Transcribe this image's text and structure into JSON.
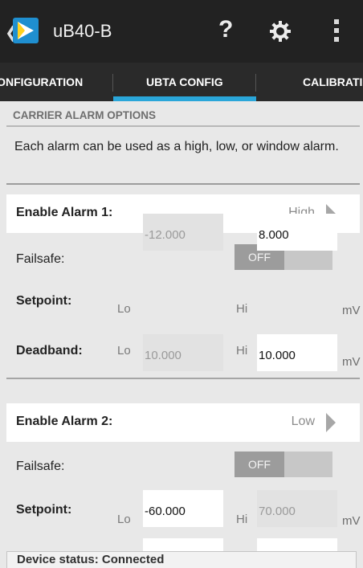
{
  "app": {
    "title": "uB40-B"
  },
  "toolbar": {
    "help_glyph": "?"
  },
  "tabs": [
    {
      "label": "CONFIGURATION"
    },
    {
      "label": "UBTA CONFIG"
    },
    {
      "label": "CALIBRATION"
    }
  ],
  "carrier_alarm": {
    "header": "CARRIER ALARM OPTIONS",
    "description": "Each alarm can be used as a high, low, or window alarm."
  },
  "alarms": [
    {
      "title": "Enable Alarm 1:",
      "mode": "High",
      "failsafe_label": "Failsafe:",
      "failsafe_state": "OFF",
      "setpoint_label": "Setpoint:",
      "setpoint_lo": "-12.000",
      "setpoint_hi": "8.000",
      "deadband_label": "Deadband:",
      "deadband_lo": "10.000",
      "deadband_hi": "10.000",
      "lo_label": "Lo",
      "hi_label": "Hi",
      "unit": "mV"
    },
    {
      "title": "Enable Alarm 2:",
      "mode": "Low",
      "failsafe_label": "Failsafe:",
      "failsafe_state": "OFF",
      "setpoint_label": "Setpoint:",
      "setpoint_lo": "-60.000",
      "setpoint_hi": "70.000",
      "lo_label": "Lo",
      "hi_label": "Hi",
      "unit": "mV"
    }
  ],
  "status": {
    "text": "Device status:  Connected"
  },
  "colors": {
    "accent": "#2aa6d9",
    "topbar": "#222222",
    "logo": "#1f8fd0"
  }
}
